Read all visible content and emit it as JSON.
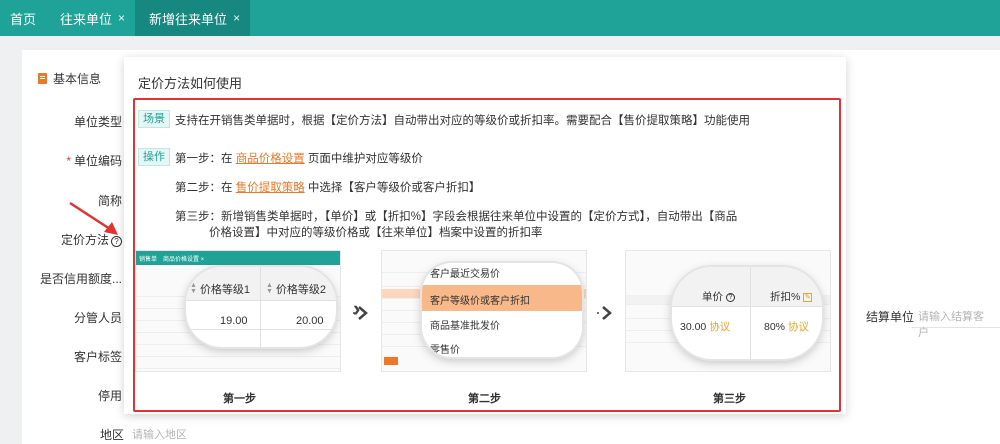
{
  "tabs": [
    {
      "label": "首页",
      "closable": false,
      "active": false
    },
    {
      "label": "往来单位",
      "closable": true,
      "active": false
    },
    {
      "label": "新增往来单位",
      "closable": true,
      "active": true
    }
  ],
  "close_glyph": "×",
  "form": {
    "section_title": "基本信息",
    "fields": {
      "unit_type": "单位类型",
      "unit_code": "单位编码",
      "short_name": "简称",
      "pricing_method": "定价方法",
      "credit_limit": "是否信用额度...",
      "manager": "分管人员",
      "customer_tag": "客户标签",
      "disabled": "停用",
      "region": "地区"
    },
    "region_placeholder": "请输入地区",
    "settle_label": "结算单位",
    "settle_placeholder": "请输入结算客户",
    "required_mark": "*",
    "help_glyph": "?"
  },
  "popover": {
    "title": "定价方法如何使用",
    "scene_tag": "场景",
    "scene_text": "支持在开销售类单据时，根据【定价方法】自动带出对应的等级价或折扣率。需要配合【售价提取策略】功能使用",
    "op_tag": "操作",
    "step1_pre": "第一步：在 ",
    "step1_link": "商品价格设置",
    "step1_post": " 页面中维护对应等级价",
    "step2_pre": "第二步：在 ",
    "step2_link": "售价提取策略",
    "step2_post": " 中选择【客户等级价或客户折扣】",
    "step3_line1": "第三步：新增销售类单据时，【单价】或【折扣%】字段会根据往来单位中设置的【定价方式】，自动带出【商品",
    "step3_line2": "价格设置】中对应的等级价格或【往来单位】档案中设置的折扣率",
    "images": {
      "step1": {
        "tabs": [
          "销售单",
          "商品价格设置 ×"
        ],
        "col1": "价格等级1",
        "col2": "价格等级2",
        "val1": "19.00",
        "val2": "20.00",
        "label": "第一步"
      },
      "step2": {
        "options": [
          "客户最近交易价",
          "客户等级价或客户折扣",
          "商品基准批发价",
          "零售价"
        ],
        "selected_index": 1,
        "label": "第二步"
      },
      "step3": {
        "col1": "单价",
        "col2": "折扣%",
        "val1": "30.00",
        "val2": "80%",
        "proto": "协议",
        "label": "第三步"
      }
    }
  },
  "colors": {
    "brand": "#1fa399",
    "accent": "#f0772a",
    "highlight": "#e43232"
  }
}
